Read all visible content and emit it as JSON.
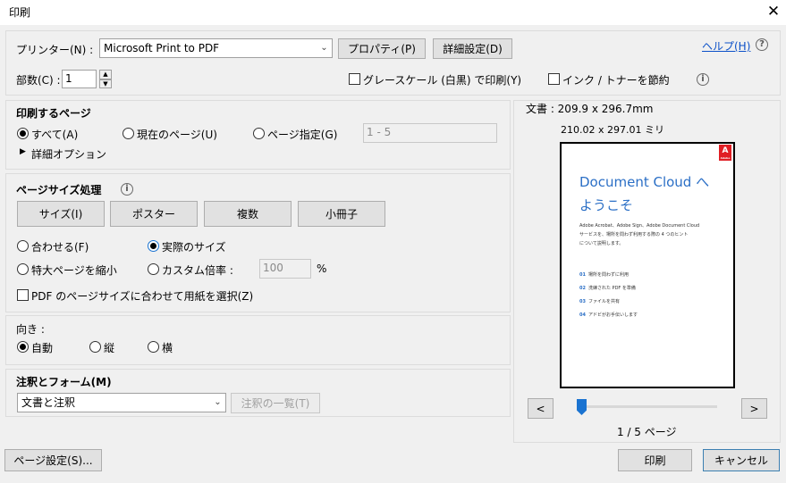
{
  "window": {
    "title": "印刷",
    "close_glyph": "✕"
  },
  "printer": {
    "label": "プリンター(N) :",
    "selected": "Microsoft Print to PDF",
    "properties_button": "プロパティ(P)",
    "advanced_button": "詳細設定(D)",
    "help_link": "ヘルプ(H)",
    "copies_label": "部数(C) :",
    "copies_value": "1",
    "grayscale_label": "グレースケール (白黒) で印刷(Y)",
    "save_ink_label": "インク / トナーを節約"
  },
  "pages_to_print": {
    "heading": "印刷するページ",
    "all": "すべて(A)",
    "current": "現在のページ(U)",
    "range": "ページ指定(G)",
    "range_placeholder": "1 - 5",
    "more_options": "詳細オプション"
  },
  "sizing": {
    "heading": "ページサイズ処理",
    "tabs": [
      "サイズ(I)",
      "ポスター",
      "複数",
      "小冊子"
    ],
    "fit": "合わせる(F)",
    "actual": "実際のサイズ",
    "shrink": "特大ページを縮小",
    "custom": "カスタム倍率 :",
    "custom_value": "100",
    "percent": "%",
    "choose_paper": "PDF のページサイズに合わせて用紙を選択(Z)"
  },
  "orientation": {
    "heading": "向き :",
    "auto": "自動",
    "portrait": "縦",
    "landscape": "横"
  },
  "comments": {
    "heading": "注釈とフォーム(M)",
    "selected": "文書と注釈",
    "summarize_button": "注釈の一覧(T)"
  },
  "preview": {
    "doc_size": "文書 : 209.9 x 296.7mm",
    "paper_size": "210.02 x 297.01 ミリ",
    "doc_title_line1": "Document Cloud へ",
    "doc_title_line2": "ようこそ",
    "adobe_text": "Adobe",
    "intro_line1": "Adobe Acrobat、Adobe Sign、Adobe Document Cloud",
    "intro_line2": "サービスを、場所を問わず利用する際の 4 つのヒント",
    "intro_line3": "について説明します。",
    "items": [
      {
        "num": "01",
        "text": "場所を問わずに利用"
      },
      {
        "num": "02",
        "text": "洗練された PDF を準備"
      },
      {
        "num": "03",
        "text": "ファイルを共有"
      },
      {
        "num": "04",
        "text": "アドビがお手伝いします"
      }
    ],
    "prev_button": "<",
    "next_button": ">",
    "page_indicator": "1 / 5 ページ",
    "slider_fraction": 0.0
  },
  "footer": {
    "page_setup_button": "ページ設定(S)...",
    "print_button": "印刷",
    "cancel_button": "キャンセル"
  },
  "colors": {
    "link": "#0b50c8",
    "accent": "#1a73d1",
    "adobe_red": "#e01e24",
    "doc_heading": "#2b6fc6"
  }
}
